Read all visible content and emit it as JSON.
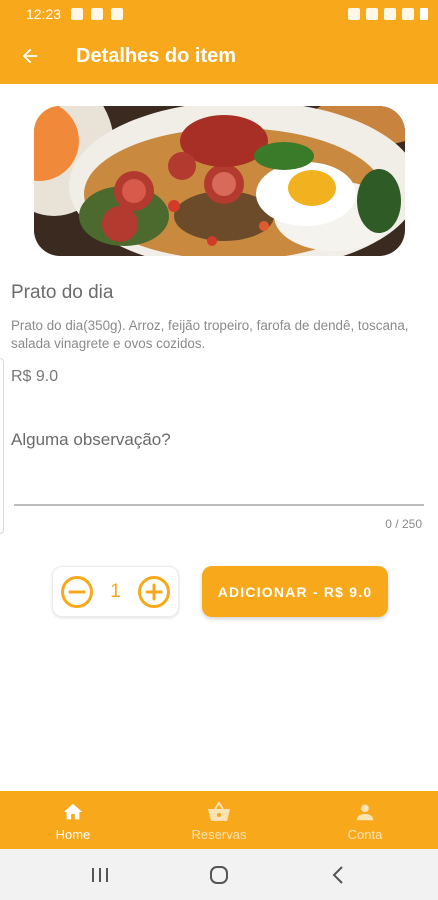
{
  "status_bar": {
    "time": "12:23"
  },
  "app_bar": {
    "title": "Detalhes do item"
  },
  "item": {
    "name": "Prato do dia",
    "description": "Prato do dia(350g). Arroz, feijão tropeiro, farofa de dendê, toscana, salada vinagrete e ovos cozidos.",
    "price": "R$ 9.0"
  },
  "observation": {
    "label": "Alguma observação?",
    "value": "",
    "counter": "0 / 250"
  },
  "quantity": {
    "value": "1"
  },
  "add_button": {
    "label": "ADICIONAR - R$ 9.0"
  },
  "bottom_nav": {
    "items": [
      {
        "label": "Home",
        "icon": "home-icon",
        "active": true
      },
      {
        "label": "Reservas",
        "icon": "basket-icon",
        "active": false
      },
      {
        "label": "Conta",
        "icon": "person-icon",
        "active": false
      }
    ]
  },
  "colors": {
    "primary": "#f7a81b",
    "text_muted": "#8a8a8a",
    "text": "#6b6b6b"
  },
  "icons": {
    "back": "arrow-back-icon",
    "minus": "minus-circle-icon",
    "plus": "plus-circle-icon",
    "sys_recent": "recent-apps-icon",
    "sys_home": "home-circle-icon",
    "sys_back": "chevron-left-icon"
  }
}
